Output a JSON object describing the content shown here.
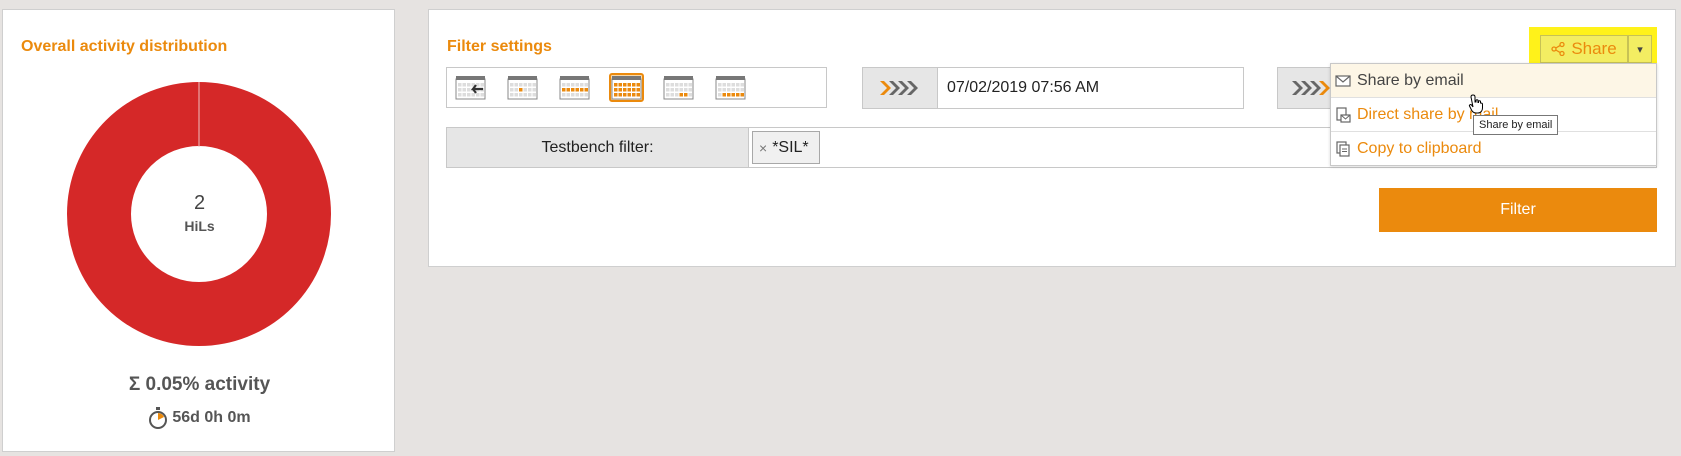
{
  "distribution": {
    "title": "Overall activity distribution",
    "count": "2",
    "unit": "HiLs",
    "activity": "Σ 0.05% activity",
    "duration": "56d 0h 0m",
    "ring_color": "#d52828"
  },
  "filter": {
    "title": "Filter settings",
    "calendar_options": [
      "calendar-back-icon",
      "calendar-day-icon",
      "calendar-week-icon",
      "calendar-month-icon",
      "calendar-quarter-icon",
      "calendar-year-icon"
    ],
    "selected_calendar_index": 3,
    "start_date": "07/02/2019 07:56 AM",
    "testbench_label": "Testbench filter:",
    "testbench_tag": "*SIL*",
    "filter_button": "Filter"
  },
  "share": {
    "label": "Share",
    "caret": "▾",
    "menu": [
      "Share by email",
      "Direct share by mail",
      "Copy to clipboard"
    ],
    "tooltip": "Share by email",
    "highlight_color": "#fff21a"
  },
  "colors": {
    "accent": "#eb8a0d"
  }
}
